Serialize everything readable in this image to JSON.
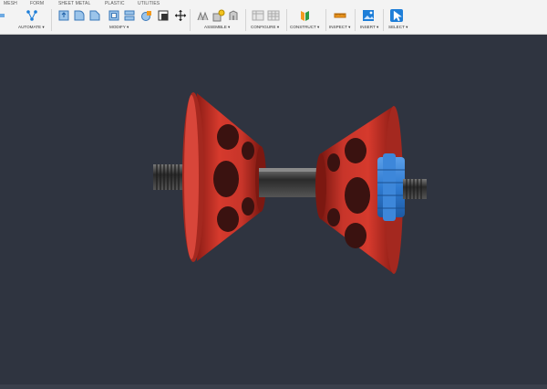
{
  "toolbar": {
    "tabs": [
      {
        "label": "MESH"
      },
      {
        "label": "FORM"
      },
      {
        "label": "SHEET METAL"
      },
      {
        "label": "PLASTIC"
      },
      {
        "label": "UTILITIES"
      }
    ],
    "groups": {
      "automate": "AUTOMATE ▾",
      "modify": "MODIFY ▾",
      "assemble": "ASSEMBLE ▾",
      "configure": "CONFIGURE ▾",
      "construct": "CONSTRUCT ▾",
      "inspect": "INSPECT ▾",
      "insert": "INSERT ▾",
      "select": "SELECT ▾"
    }
  },
  "viewport": {
    "background": "#2f3440",
    "model": {
      "part_color": "#c8352a",
      "knob_color": "#2f7bd1",
      "thread_color": "#444444"
    }
  },
  "colors": {
    "toolbar_bg": "#f3f3f3",
    "icon_blue": "#1e7ed8",
    "icon_orange": "#f29a1f",
    "icon_green": "#2e9b44"
  }
}
